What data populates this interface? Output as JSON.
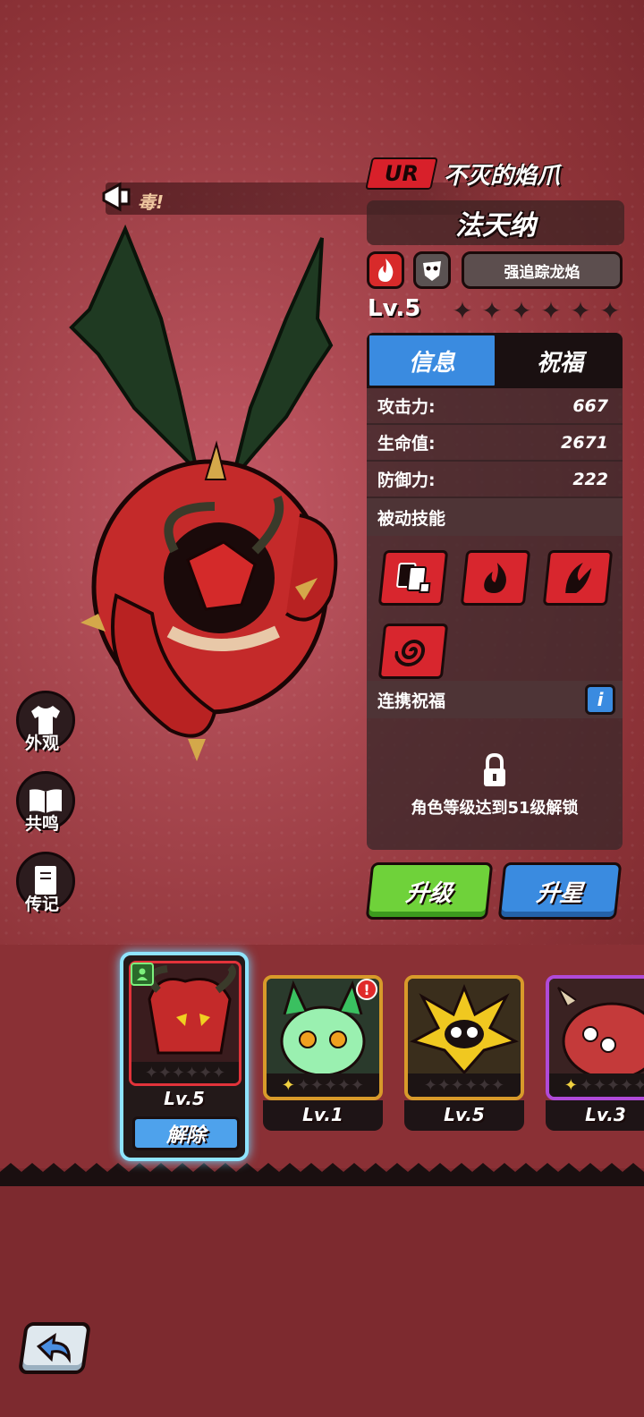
{
  "chat": {
    "text": "毒!"
  },
  "hero": {
    "rarity": "UR",
    "epithet": "不灭的焰爪",
    "name": "法天纳",
    "element_icon": "fire-icon",
    "class_icon": "mask-icon",
    "skill_name": "强追踪龙焰",
    "level": "Lv.5",
    "stars_filled": 0,
    "stars_total": 6
  },
  "panel": {
    "tabs": [
      {
        "label": "信息",
        "active": true
      },
      {
        "label": "祝福",
        "active": false
      }
    ],
    "stats": [
      {
        "label": "攻击力:",
        "value": "667"
      },
      {
        "label": "生命值:",
        "value": "2671"
      },
      {
        "label": "防御力:",
        "value": "222"
      }
    ],
    "passive_header": "被动技能",
    "passive_skills": [
      "cards-dice-icon",
      "flame-icon",
      "claw-flame-icon",
      "spiral-icon"
    ],
    "bond_header": "连携祝福",
    "info_icon": "i",
    "lock_text": "角色等级达到51级解锁"
  },
  "buttons": {
    "upgrade": "升级",
    "star_up": "升星"
  },
  "side_menu": [
    {
      "label": "外观",
      "icon": "shirt-icon"
    },
    {
      "label": "共鸣",
      "icon": "book-icon"
    },
    {
      "label": "传记",
      "icon": "journal-icon"
    }
  ],
  "cards": [
    {
      "level": "Lv.5",
      "selected": true,
      "action": "解除",
      "portrait": "red-horned-demon"
    },
    {
      "level": "Lv.1",
      "selected": false,
      "portrait": "green-spirit-owl",
      "alert": "!"
    },
    {
      "level": "Lv.5",
      "selected": false,
      "portrait": "yellow-spiky-creature"
    },
    {
      "level": "Lv.3",
      "selected": false,
      "portrait": "red-horned-beast"
    }
  ],
  "colors": {
    "accent_blue": "#3a8be0",
    "accent_green": "#6fd23a",
    "rarity_red": "#d8202a"
  }
}
